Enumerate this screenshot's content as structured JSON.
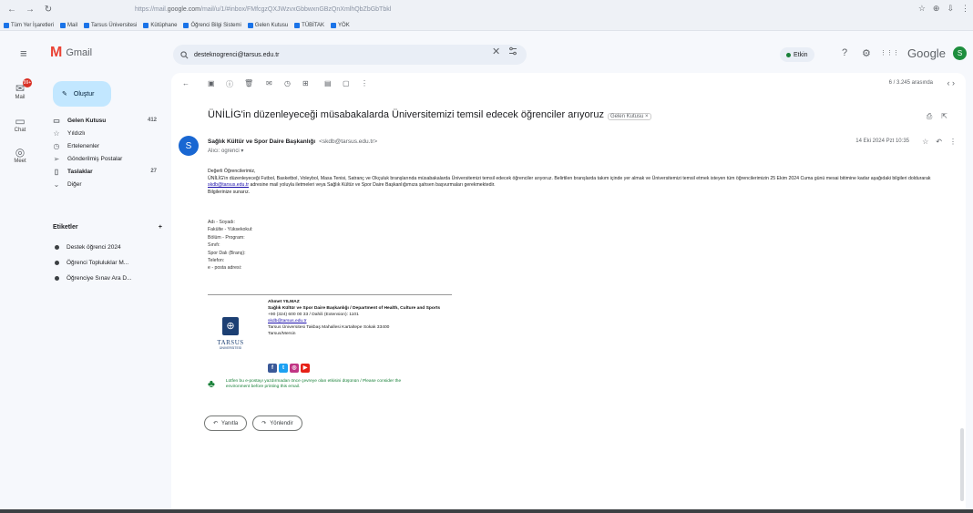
{
  "browser": {
    "back_glyph": "←",
    "forward_glyph": "→",
    "reload_glyph": "↻",
    "url_prefix": "https://mail.",
    "url_host": "google.com",
    "url_rest": "/mail/u/1/#inbox/FMfcgzQXJWzvxGbbwxnGBzQnXmlhQbZbGbTbkl",
    "right_icons": [
      "☆",
      "⊕",
      "⇩",
      "⋮"
    ],
    "bookmarks": [
      "Tüm Yer İşaretleri",
      "Mail",
      "Tarsus Üniversitesi",
      "Kütüphane",
      "Öğrenci Bilgi Sistemi",
      "Gelen Kutusu",
      "TÜBİTAK",
      "YÖK"
    ]
  },
  "gmail": {
    "logo_letter": "M",
    "logo_text": "Gmail",
    "menu_glyph": "≡",
    "search_value": "desteknogrenci@tarsus.edu.tr",
    "search_clear": "✕",
    "status_label": "Etkin",
    "header_icons": [
      "?",
      "⚙",
      "⋮⋮⋮"
    ],
    "google_word": "Google",
    "avatar_letter": "S"
  },
  "rail": {
    "mail_badge": "99+",
    "items": [
      "Mail",
      "Chat",
      "Meet"
    ]
  },
  "compose_label": "Oluştur",
  "sidebar": {
    "items": [
      {
        "icon": "▭",
        "label": "Gelen Kutusu",
        "count": "412",
        "bold": true
      },
      {
        "icon": "☆",
        "label": "Yıldızlı",
        "count": ""
      },
      {
        "icon": "◷",
        "label": "Ertelenenler",
        "count": ""
      },
      {
        "icon": "➢",
        "label": "Gönderilmiş Postalar",
        "count": ""
      },
      {
        "icon": "▯",
        "label": "Taslaklar",
        "count": "27",
        "bold": true
      },
      {
        "icon": "⌄",
        "label": "Diğer",
        "count": ""
      }
    ],
    "labels_header": "Etiketler",
    "labels_add": "+",
    "labels": [
      "Destek öğrenci 2024",
      "Öğrenci Topluluklar M...",
      "Öğrenciye Sınav Ara D..."
    ]
  },
  "toolbar": {
    "icons": [
      "←",
      "▣",
      "ⓘ",
      "🗑",
      "✉",
      "◷",
      "⊞",
      "▤",
      "▢",
      "⋮"
    ],
    "pager": "6 / 3.245 arasında",
    "pager_arrows": "‹   ›"
  },
  "email": {
    "subject": "ÜNİLİG'in düzenleyeceği müsabakalarda Üniversitemizi temsil edecek öğrenciler arıyoruz",
    "inbox_chip": "Gelen Kutusu ×",
    "subject_icons": [
      "⎙",
      "⇱"
    ],
    "sender_initial": "S",
    "sender_name": "Sağlık Kültür ve Spor Daire Başkanlığı",
    "sender_email": "<skdb@tarsus.edu.tr>",
    "to": "Alıcı: ogrenci ▾",
    "date": "14 Eki 2024 Pzt 10:35",
    "msg_actions": [
      "☆",
      "↶",
      "⋮"
    ],
    "greeting": "Değerli Öğrencilerimiz,",
    "para_before_link": "ÜNİLİG'in düzenleyeceği Futbol, Basketbol, Voleybol, Masa Tenisi, Satranç ve Okçuluk branşlarında müsabakalarda Üniversitemizi temsil edecek öğrenciler arıyoruz. Belirtilen branşlarda takım içinde yer almak ve Üniversitemizi temsil etmek isteyen tüm öğrencilerimizin 25 Ekim 2024 Cuma günü mesai bitimine kadar aşağıdaki bilgileri doldurarak",
    "para_link": "skdb@tarsus.edu.tr",
    "para_after_link": "adresine mail yoluyla iletmeleri veya Sağlık Kültür ve Spor Daire Başkanlığımıza şahsen başvurmaları gerekmektedir.",
    "closing": "Bilgilerinize sunarız.",
    "fields": [
      "Adı - Soyadı:",
      "Fakülte - Yüksekokul:",
      "Bölüm - Program:",
      "Sınıfı:",
      "Spor Dalı (Branş):",
      "Telefon:",
      "e - posta adresi:"
    ]
  },
  "signature": {
    "line1": "Ahmet YILMAZ",
    "line2": "Sağlık Kültür ve Spor Daire Başkanlığı / Department of Health, Culture and Sports",
    "line3": "+90 (324) 600 00 33 / Dahili (Extension): 1101",
    "email": "skdb@tarsus.edu.tr",
    "line4": "Tarsus Üniversitesi Takbaş Mahallesi Kartaltepe Sokak 33400",
    "line5": "Tarsus/Mersin",
    "badge_glyph": "⊕",
    "uni_name": "TARSUS",
    "uni_sub": "ÜNİVERSİTESİ",
    "social": [
      {
        "glyph": "f",
        "color": "#3b5998"
      },
      {
        "glyph": "t",
        "color": "#1da1f2"
      },
      {
        "glyph": "◎",
        "color": "#c13584"
      },
      {
        "glyph": "▶",
        "color": "#e62117"
      }
    ],
    "green_glyph": "♣",
    "green_text": "Lütfen bu e-postayı yazdırmadan önce çevreye olan etkisini düşünün / Please consider the environment before printing this email."
  },
  "reply": {
    "reply_label": "Yanıtla",
    "reply_glyph": "↶",
    "forward_label": "Yönlendir",
    "forward_glyph": "↷"
  }
}
